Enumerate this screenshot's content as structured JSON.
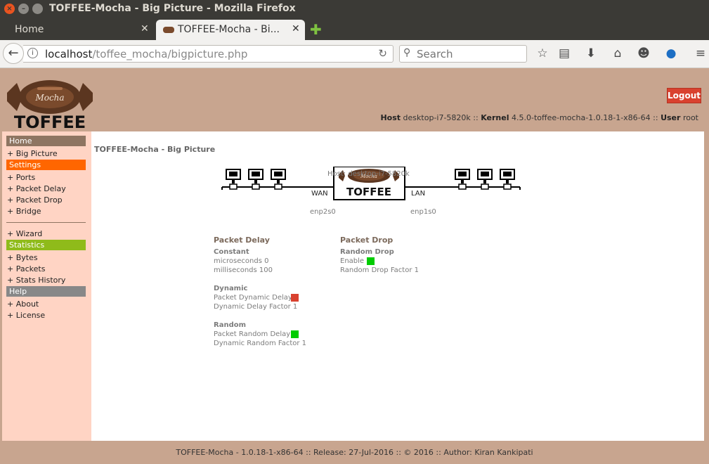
{
  "window": {
    "title": "TOFFEE-Mocha - Big Picture - Mozilla Firefox"
  },
  "tabs": [
    {
      "label": "Home"
    },
    {
      "label": "TOFFEE-Mocha - Bi..."
    }
  ],
  "navbar": {
    "url_host": "localhost",
    "url_path": "/toffee_mocha/bigpicture.php",
    "search_placeholder": "Search"
  },
  "header": {
    "logo_text_top": "Mocha",
    "logo_text_bottom": "TOFFEE",
    "logout_label": "Logout",
    "host_label": "Host",
    "host_value": "desktop-i7-5820k",
    "kernel_label": "Kernel",
    "kernel_value": "4.5.0-toffee-mocha-1.0.18-1-x86-64",
    "user_label": "User",
    "user_value": "root",
    "separator": "::"
  },
  "sidebar": {
    "home": "Home",
    "big_picture": "+ Big Picture",
    "settings": "Settings",
    "ports": "+ Ports",
    "packet_delay": "+ Packet Delay",
    "packet_drop": "+ Packet Drop",
    "bridge": "+ Bridge",
    "wizard": "+ Wizard",
    "statistics": "Statistics",
    "bytes": "+ Bytes",
    "packets": "+ Packets",
    "stats_history": "+ Stats History",
    "help": "Help",
    "about": "+ About",
    "license": "+ License"
  },
  "main": {
    "title": "TOFFEE-Mocha - Big Picture",
    "diagram": {
      "host_label": "Host: desktop-i7-5820k",
      "wan_label": "WAN",
      "lan_label": "LAN",
      "wan_iface": "enp2s0",
      "lan_iface": "enp1s0",
      "box_logo_small": "Mocha",
      "box_logo_big": "TOFFEE"
    },
    "packet_delay": {
      "title": "Packet Delay",
      "constant_title": "Constant",
      "microseconds": "microseconds 0",
      "milliseconds": "milliseconds 100",
      "dynamic_title": "Dynamic",
      "dynamic_enable_label": "Packet Dynamic Delay",
      "dynamic_factor": "Dynamic Delay Factor 1",
      "random_title": "Random",
      "random_enable_label": "Packet Random Delay",
      "random_factor": "Dynamic Random Factor 1"
    },
    "packet_drop": {
      "title": "Packet Drop",
      "random_title": "Random Drop",
      "enable_label": "Enable",
      "factor": "Random Drop Factor 1"
    }
  },
  "colors": {
    "status_on": "#00cc00",
    "status_off": "#d9412f"
  },
  "footer": {
    "text": "TOFFEE-Mocha - 1.0.18-1-x86-64 :: Release: 27-Jul-2016 :: © 2016 :: Author: Kiran Kankipati"
  }
}
